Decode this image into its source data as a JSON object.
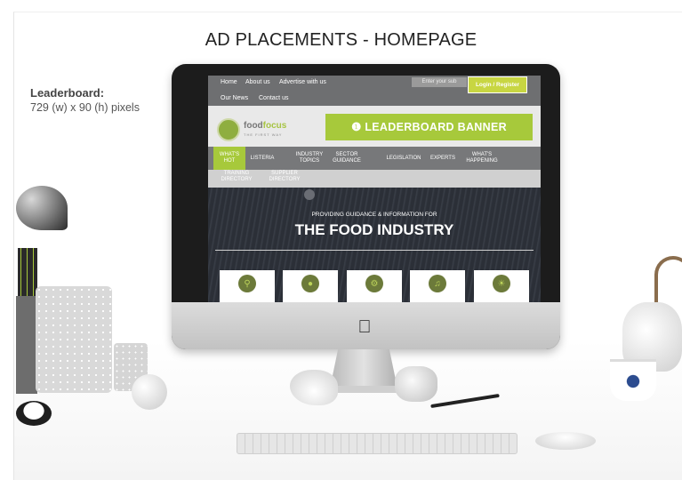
{
  "slide": {
    "title": "AD PLACEMENTS - HOMEPAGE",
    "spec_name": "Leaderboard:",
    "spec_size": "729 (w) x 90 (h) pixels"
  },
  "site": {
    "top_nav": [
      "Home",
      "About us",
      "Advertise with us",
      "Our News",
      "Contact us"
    ],
    "search_placeholder": "Enter your sub",
    "login_label": "Login / Register",
    "logo_text_a": "food",
    "logo_text_b": "focus",
    "logo_tagline": "THE FIRST WAY",
    "banner_label": "❶ LEADERBOARD BANNER",
    "menu": [
      "WHAT'S HOT",
      "LISTERIA",
      "INDUSTRY TOPICS",
      "SECTOR GUIDANCE",
      "LEGISLATION",
      "EXPERTS",
      "WHAT'S HAPPENING"
    ],
    "submenu": [
      "TRAINING DIRECTORY",
      "SUPPLIER DIRECTORY"
    ],
    "hero_kicker": "PROVIDING GUIDANCE & INFORMATION FOR",
    "hero_title": "THE FOOD INDUSTRY",
    "tiles": [
      "search-icon",
      "tag-icon",
      "microscope-icon",
      "microphone-icon",
      "lightbulb-icon"
    ]
  },
  "colors": {
    "accent": "#a7c93b",
    "nav_dark": "#6e6f71",
    "hero": "#2f3238"
  }
}
